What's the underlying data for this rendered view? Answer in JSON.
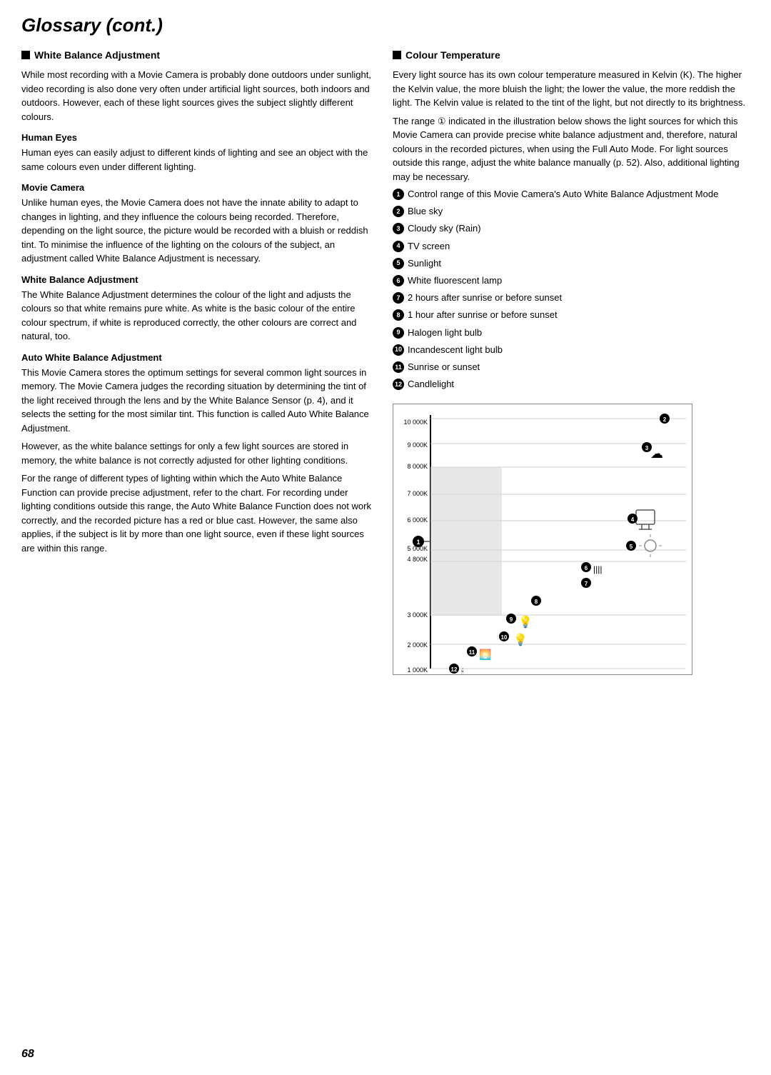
{
  "page": {
    "title": "Glossary (cont.)",
    "page_number": "68"
  },
  "left_section": {
    "heading": "White Balance Adjustment",
    "intro": "While most recording with a Movie Camera is probably done outdoors under sunlight, video recording is also done very often under artificial light sources, both indoors and outdoors. However, each of these light sources gives the subject slightly different colours.",
    "subsections": [
      {
        "title": "Human Eyes",
        "body": "Human eyes can easily adjust to different kinds of lighting and see an object with the same colours even under different lighting."
      },
      {
        "title": "Movie Camera",
        "body": "Unlike human eyes, the Movie Camera does not have the innate ability to adapt to changes in lighting, and they influence the colours being recorded. Therefore, depending on the light source, the picture would be recorded with a bluish or reddish tint. To minimise the influence of the lighting on the colours of the subject, an adjustment called White Balance Adjustment is necessary."
      },
      {
        "title": "White Balance Adjustment",
        "body": "The White Balance Adjustment determines the colour of the light and adjusts the colours so that white remains pure white. As white is the basic colour of the entire colour spectrum, if white is reproduced correctly, the other colours are correct and natural, too."
      },
      {
        "title": "Auto White Balance Adjustment",
        "body1": "This Movie Camera stores the optimum settings for several common light sources in memory. The Movie Camera judges the recording situation by determining the tint of the light received through the lens and by the White Balance Sensor (p. 4), and it selects the setting for the most similar tint. This function is called Auto White Balance Adjustment.",
        "body2": "However, as the white balance settings for only a few light sources are stored in memory, the white balance is not correctly adjusted for other lighting conditions.",
        "body3": "For the range of different types of lighting within which the Auto White Balance Function can provide precise adjustment, refer to the chart. For recording under lighting conditions outside this range, the Auto White Balance Function does not work correctly, and the recorded picture has a red or blue cast. However, the same also applies, if the subject is lit by more than one light source, even if these light sources are within this range."
      }
    ]
  },
  "right_section": {
    "heading": "Colour Temperature",
    "intro": "Every light source has its own colour temperature measured in Kelvin (K). The higher the Kelvin value, the more bluish the light; the lower the value, the more reddish the light. The Kelvin value is related to the tint of the light, but not directly to its brightness.",
    "range_note": "The range ① indicated in the illustration below shows the light sources for which this Movie Camera can provide precise white balance adjustment and, therefore, natural colours in the recorded pictures, when using the Full Auto Mode. For light sources outside this range, adjust the white balance manually (p. 52). Also, additional lighting may be necessary.",
    "items": [
      {
        "num": "1",
        "text": "Control range of this Movie Camera's Auto White Balance Adjustment Mode"
      },
      {
        "num": "2",
        "text": "Blue sky"
      },
      {
        "num": "3",
        "text": "Cloudy sky (Rain)"
      },
      {
        "num": "4",
        "text": "TV screen"
      },
      {
        "num": "5",
        "text": "Sunlight"
      },
      {
        "num": "6",
        "text": "White fluorescent lamp"
      },
      {
        "num": "7",
        "text": "2 hours after sunrise or before sunset"
      },
      {
        "num": "8",
        "text": "1 hour after sunrise or before sunset"
      },
      {
        "num": "9",
        "text": "Halogen light bulb"
      },
      {
        "num": "10",
        "text": "Incandescent light bulb"
      },
      {
        "num": "11",
        "text": "Sunrise or sunset"
      },
      {
        "num": "12",
        "text": "Candlelight"
      }
    ]
  },
  "chart": {
    "y_labels": [
      "1 000K",
      "2 000K",
      "3 000K",
      "4 800K",
      "5 000K",
      "6 000K",
      "7 000K",
      "8 000K",
      "9 000K",
      "10 000K"
    ]
  }
}
